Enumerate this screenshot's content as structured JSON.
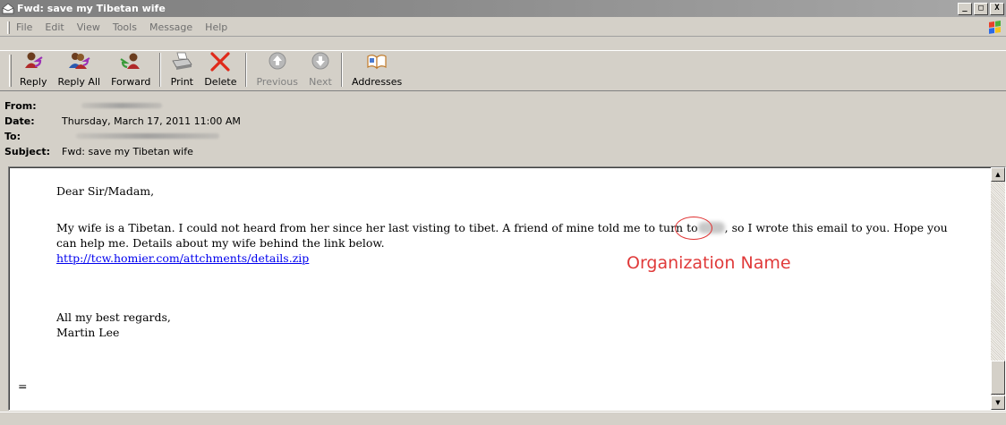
{
  "window": {
    "title": "Fwd: save my Tibetan wife",
    "minimize_glyph": "_",
    "maximize_glyph": "□",
    "close_glyph": "X"
  },
  "menu": [
    "File",
    "Edit",
    "View",
    "Tools",
    "Message",
    "Help"
  ],
  "toolbar": {
    "reply": "Reply",
    "reply_all": "Reply All",
    "forward": "Forward",
    "print": "Print",
    "delete": "Delete",
    "previous": "Previous",
    "next": "Next",
    "addresses": "Addresses"
  },
  "headers": {
    "from_label": "From:",
    "date_label": "Date:",
    "date_value": "Thursday, March 17, 2011 11:00 AM",
    "to_label": "To:",
    "subject_label": "Subject:",
    "subject_value": "Fwd: save my Tibetan wife"
  },
  "message": {
    "greeting": "Dear Sir/Madam,",
    "line1_before": "My wife is a Tibetan. I could not heard from her since her last visting to tibet. A friend of mine told me to turn to",
    "line1_after": ", so I wrote this email to you. Hope you",
    "line2": "can help me. Details about my wife behind the link below.",
    "link": "http://tcw.homier.com/attchments/details.zip",
    "closing": "All my best regards,",
    "signature": "Martin Lee",
    "trailer": "="
  },
  "annotation": {
    "label": "Organization Name",
    "color": "#e03a3a"
  }
}
